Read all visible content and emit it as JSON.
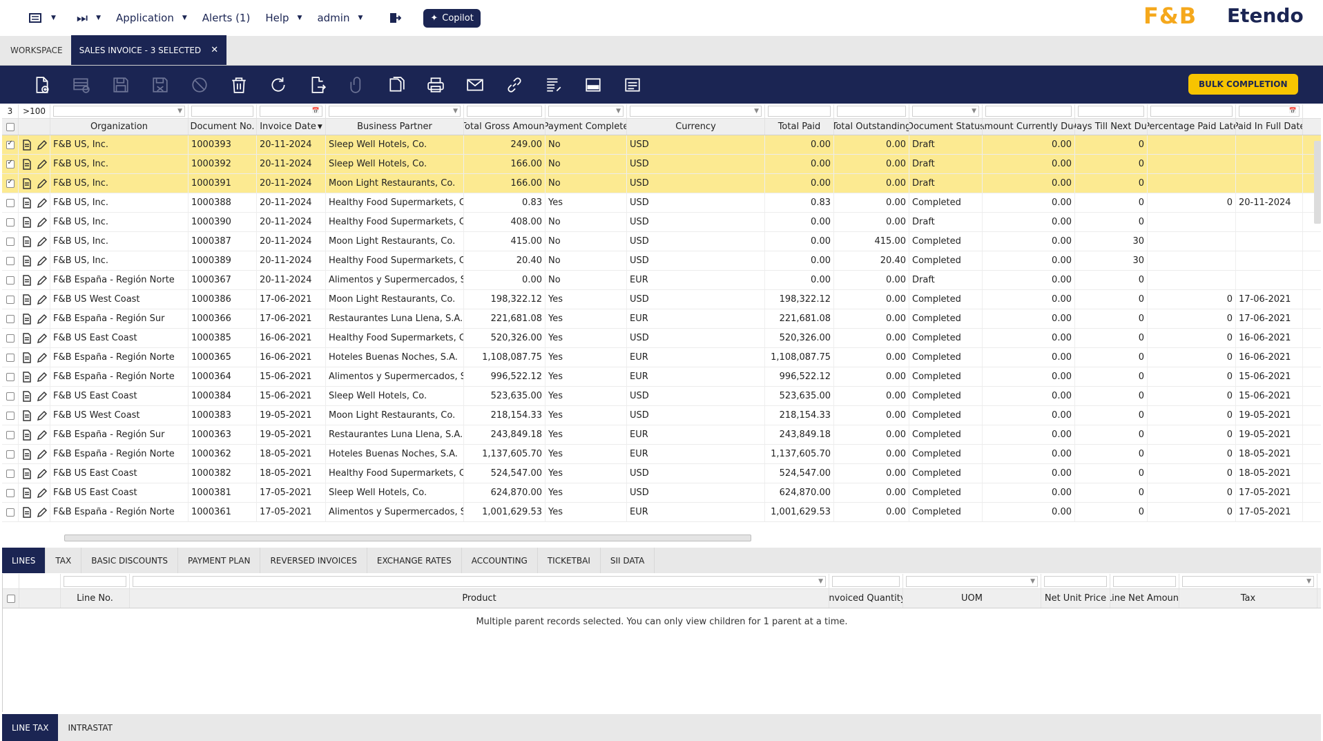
{
  "topbar": {
    "menu_icon": "list-icon",
    "nav_icon": "skip-forward-icon",
    "application": "Application",
    "alerts": "Alerts (1)",
    "help": "Help",
    "user": "admin",
    "logout_icon": "logout-icon",
    "copilot": "Copilot",
    "logo_fb": "F&B",
    "logo_etendo": "Etendo"
  },
  "window_tabs": [
    "WORKSPACE",
    "SALES INVOICE - 3 SELECTED"
  ],
  "toolbar": {
    "buttons": [
      "new-document",
      "new-in-grid",
      "save",
      "save-close",
      "undo",
      "delete",
      "refresh",
      "export",
      "attach",
      "clone",
      "print",
      "email",
      "link",
      "audit",
      "toggle-form",
      "reports"
    ],
    "bulk_label": "BULK COMPLETION"
  },
  "grid": {
    "filter_count": "3",
    "filter_total": ">100",
    "columns": [
      "Organization",
      "Document No.",
      "Invoice Date",
      "Business Partner",
      "Total Gross Amount",
      "Payment Complete",
      "Currency",
      "Total Paid",
      "Total Outstanding",
      "Document Status",
      "Amount Currently Due",
      "Days Till Next Due",
      "Percentage Paid Late",
      "Paid In Full Date"
    ],
    "sort_indicator": "▼",
    "rows": [
      {
        "sel": true,
        "org": "F&B US, Inc.",
        "doc": "1000393",
        "date": "20-11-2024",
        "bp": "Sleep Well Hotels, Co.",
        "gross": "249.00",
        "pc": "No",
        "cur": "USD",
        "paid": "0.00",
        "out": "0.00",
        "status": "Draft",
        "due": "0.00",
        "days": "0",
        "late": "",
        "full": ""
      },
      {
        "sel": true,
        "org": "F&B US, Inc.",
        "doc": "1000392",
        "date": "20-11-2024",
        "bp": "Sleep Well Hotels, Co.",
        "gross": "166.00",
        "pc": "No",
        "cur": "USD",
        "paid": "0.00",
        "out": "0.00",
        "status": "Draft",
        "due": "0.00",
        "days": "0",
        "late": "",
        "full": ""
      },
      {
        "sel": true,
        "org": "F&B US, Inc.",
        "doc": "1000391",
        "date": "20-11-2024",
        "bp": "Moon Light Restaurants, Co.",
        "gross": "166.00",
        "pc": "No",
        "cur": "USD",
        "paid": "0.00",
        "out": "0.00",
        "status": "Draft",
        "due": "0.00",
        "days": "0",
        "late": "",
        "full": ""
      },
      {
        "sel": false,
        "org": "F&B US, Inc.",
        "doc": "1000388",
        "date": "20-11-2024",
        "bp": "Healthy Food Supermarkets, Co.",
        "gross": "0.83",
        "pc": "Yes",
        "cur": "USD",
        "paid": "0.83",
        "out": "0.00",
        "status": "Completed",
        "due": "0.00",
        "days": "0",
        "late": "0",
        "full": "20-11-2024"
      },
      {
        "sel": false,
        "org": "F&B US, Inc.",
        "doc": "1000390",
        "date": "20-11-2024",
        "bp": "Healthy Food Supermarkets, Co.",
        "gross": "408.00",
        "pc": "No",
        "cur": "USD",
        "paid": "0.00",
        "out": "0.00",
        "status": "Draft",
        "due": "0.00",
        "days": "0",
        "late": "",
        "full": ""
      },
      {
        "sel": false,
        "org": "F&B US, Inc.",
        "doc": "1000387",
        "date": "20-11-2024",
        "bp": "Moon Light Restaurants, Co.",
        "gross": "415.00",
        "pc": "No",
        "cur": "USD",
        "paid": "0.00",
        "out": "415.00",
        "status": "Completed",
        "due": "0.00",
        "days": "30",
        "late": "",
        "full": ""
      },
      {
        "sel": false,
        "org": "F&B US, Inc.",
        "doc": "1000389",
        "date": "20-11-2024",
        "bp": "Healthy Food Supermarkets, Co.",
        "gross": "20.40",
        "pc": "No",
        "cur": "USD",
        "paid": "0.00",
        "out": "20.40",
        "status": "Completed",
        "due": "0.00",
        "days": "30",
        "late": "",
        "full": ""
      },
      {
        "sel": false,
        "org": "F&B España - Región Norte",
        "doc": "1000367",
        "date": "20-11-2024",
        "bp": "Alimentos y Supermercados, S...",
        "gross": "0.00",
        "pc": "No",
        "cur": "EUR",
        "paid": "0.00",
        "out": "0.00",
        "status": "Draft",
        "due": "0.00",
        "days": "0",
        "late": "",
        "full": ""
      },
      {
        "sel": false,
        "org": "F&B US West Coast",
        "doc": "1000386",
        "date": "17-06-2021",
        "bp": "Moon Light Restaurants, Co.",
        "gross": "198,322.12",
        "pc": "Yes",
        "cur": "USD",
        "paid": "198,322.12",
        "out": "0.00",
        "status": "Completed",
        "due": "0.00",
        "days": "0",
        "late": "0",
        "full": "17-06-2021"
      },
      {
        "sel": false,
        "org": "F&B España - Región Sur",
        "doc": "1000366",
        "date": "17-06-2021",
        "bp": "Restaurantes Luna Llena, S.A.",
        "gross": "221,681.08",
        "pc": "Yes",
        "cur": "EUR",
        "paid": "221,681.08",
        "out": "0.00",
        "status": "Completed",
        "due": "0.00",
        "days": "0",
        "late": "0",
        "full": "17-06-2021"
      },
      {
        "sel": false,
        "org": "F&B US East Coast",
        "doc": "1000385",
        "date": "16-06-2021",
        "bp": "Healthy Food Supermarkets, Co.",
        "gross": "520,326.00",
        "pc": "Yes",
        "cur": "USD",
        "paid": "520,326.00",
        "out": "0.00",
        "status": "Completed",
        "due": "0.00",
        "days": "0",
        "late": "0",
        "full": "16-06-2021"
      },
      {
        "sel": false,
        "org": "F&B España - Región Norte",
        "doc": "1000365",
        "date": "16-06-2021",
        "bp": "Hoteles Buenas Noches, S.A.",
        "gross": "1,108,087.75",
        "pc": "Yes",
        "cur": "EUR",
        "paid": "1,108,087.75",
        "out": "0.00",
        "status": "Completed",
        "due": "0.00",
        "days": "0",
        "late": "0",
        "full": "16-06-2021"
      },
      {
        "sel": false,
        "org": "F&B España - Región Norte",
        "doc": "1000364",
        "date": "15-06-2021",
        "bp": "Alimentos y Supermercados, S...",
        "gross": "996,522.12",
        "pc": "Yes",
        "cur": "EUR",
        "paid": "996,522.12",
        "out": "0.00",
        "status": "Completed",
        "due": "0.00",
        "days": "0",
        "late": "0",
        "full": "15-06-2021"
      },
      {
        "sel": false,
        "org": "F&B US East Coast",
        "doc": "1000384",
        "date": "15-06-2021",
        "bp": "Sleep Well Hotels, Co.",
        "gross": "523,635.00",
        "pc": "Yes",
        "cur": "USD",
        "paid": "523,635.00",
        "out": "0.00",
        "status": "Completed",
        "due": "0.00",
        "days": "0",
        "late": "0",
        "full": "15-06-2021"
      },
      {
        "sel": false,
        "org": "F&B US West Coast",
        "doc": "1000383",
        "date": "19-05-2021",
        "bp": "Moon Light Restaurants, Co.",
        "gross": "218,154.33",
        "pc": "Yes",
        "cur": "USD",
        "paid": "218,154.33",
        "out": "0.00",
        "status": "Completed",
        "due": "0.00",
        "days": "0",
        "late": "0",
        "full": "19-05-2021"
      },
      {
        "sel": false,
        "org": "F&B España - Región Sur",
        "doc": "1000363",
        "date": "19-05-2021",
        "bp": "Restaurantes Luna Llena, S.A.",
        "gross": "243,849.18",
        "pc": "Yes",
        "cur": "EUR",
        "paid": "243,849.18",
        "out": "0.00",
        "status": "Completed",
        "due": "0.00",
        "days": "0",
        "late": "0",
        "full": "19-05-2021"
      },
      {
        "sel": false,
        "org": "F&B España - Región Norte",
        "doc": "1000362",
        "date": "18-05-2021",
        "bp": "Hoteles Buenas Noches, S.A.",
        "gross": "1,137,605.70",
        "pc": "Yes",
        "cur": "EUR",
        "paid": "1,137,605.70",
        "out": "0.00",
        "status": "Completed",
        "due": "0.00",
        "days": "0",
        "late": "0",
        "full": "18-05-2021"
      },
      {
        "sel": false,
        "org": "F&B US East Coast",
        "doc": "1000382",
        "date": "18-05-2021",
        "bp": "Healthy Food Supermarkets, Co.",
        "gross": "524,547.00",
        "pc": "Yes",
        "cur": "USD",
        "paid": "524,547.00",
        "out": "0.00",
        "status": "Completed",
        "due": "0.00",
        "days": "0",
        "late": "0",
        "full": "18-05-2021"
      },
      {
        "sel": false,
        "org": "F&B US East Coast",
        "doc": "1000381",
        "date": "17-05-2021",
        "bp": "Sleep Well Hotels, Co.",
        "gross": "624,870.00",
        "pc": "Yes",
        "cur": "USD",
        "paid": "624,870.00",
        "out": "0.00",
        "status": "Completed",
        "due": "0.00",
        "days": "0",
        "late": "0",
        "full": "17-05-2021"
      },
      {
        "sel": false,
        "org": "F&B España - Región Norte",
        "doc": "1000361",
        "date": "17-05-2021",
        "bp": "Alimentos y Supermercados, S...",
        "gross": "1,001,629.53",
        "pc": "Yes",
        "cur": "EUR",
        "paid": "1,001,629.53",
        "out": "0.00",
        "status": "Completed",
        "due": "0.00",
        "days": "0",
        "late": "0",
        "full": "17-05-2021"
      }
    ]
  },
  "subtabs": [
    "LINES",
    "TAX",
    "BASIC DISCOUNTS",
    "PAYMENT PLAN",
    "REVERSED INVOICES",
    "EXCHANGE RATES",
    "ACCOUNTING",
    "TICKETBAI",
    "SII DATA"
  ],
  "lines_grid": {
    "columns": [
      "Line No.",
      "Product",
      "Invoiced Quantity",
      "UOM",
      "Net Unit Price",
      "Line Net Amount",
      "Tax"
    ],
    "message": "Multiple parent records selected. You can only view children for 1 parent at a time."
  },
  "bottom_tabs": [
    "LINE TAX",
    "INTRASTAT"
  ],
  "colors": {
    "navy": "#1b2553",
    "selected_row": "#fcea91",
    "bulk": "#f7c400"
  }
}
